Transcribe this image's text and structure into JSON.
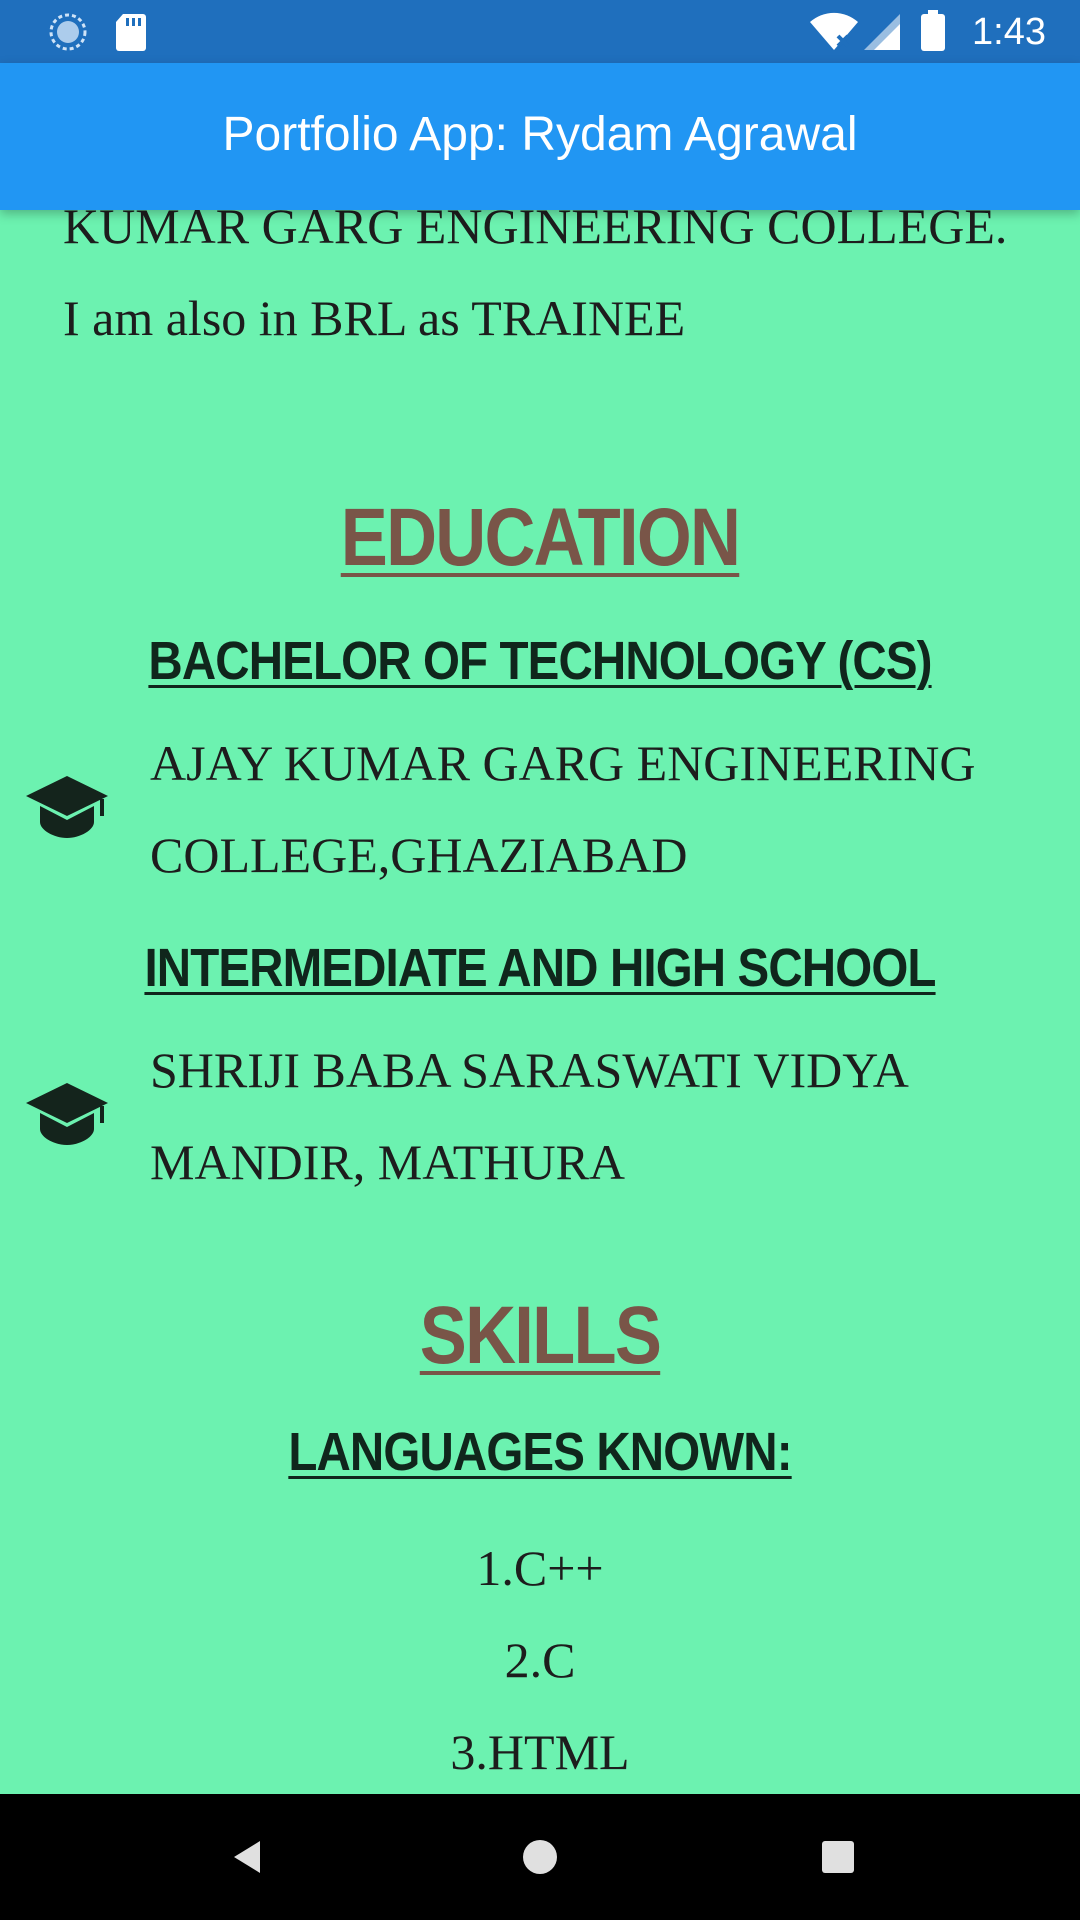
{
  "status_bar": {
    "time": "1:43",
    "icons": [
      "sync-icon",
      "sd-card-icon",
      "wifi-icon",
      "signal-icon",
      "battery-icon"
    ]
  },
  "app_bar": {
    "title": "Portfolio App: Rydam Agrawal"
  },
  "about": {
    "lines": [
      "KUMAR GARG ENGINEERING COLLEGE.",
      "I am also in BRL as TRAINEE"
    ]
  },
  "education": {
    "title": "EDUCATION",
    "entries": [
      {
        "degree": "BACHELOR OF TECHNOLOGY (CS)",
        "institution_line1": "AJAY KUMAR GARG ENGINEERING",
        "institution_line2": "COLLEGE,GHAZIABAD",
        "icon": "graduation-cap-icon"
      },
      {
        "degree": "INTERMEDIATE AND HIGH SCHOOL",
        "institution_line1": "SHRIJI BABA SARASWATI VIDYA",
        "institution_line2": "MANDIR, MATHURA",
        "icon": "graduation-cap-icon"
      }
    ]
  },
  "skills": {
    "title": "SKILLS",
    "languages_heading": "LANGUAGES KNOWN:",
    "languages": [
      "1.C++",
      "2.C",
      "3.HTML"
    ]
  },
  "colors": {
    "status_bar": "#1f6fbd",
    "app_bar": "#2196f3",
    "background": "#6cf2b0",
    "section_title": "#795548",
    "subtitle": "#10261c"
  },
  "nav_bar": {
    "icons": [
      "back-icon",
      "home-icon",
      "recents-icon"
    ]
  }
}
